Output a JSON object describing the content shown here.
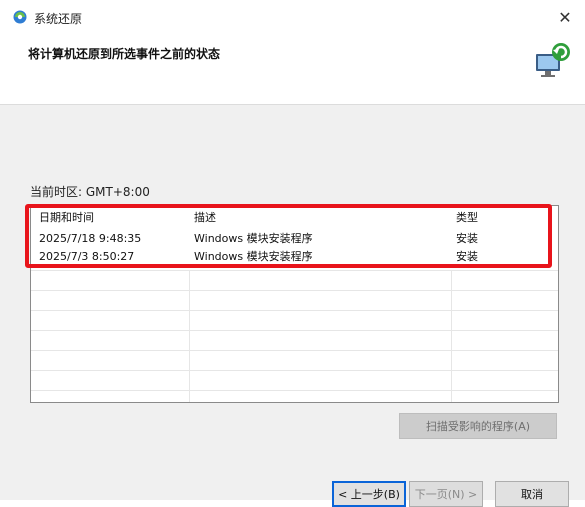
{
  "window": {
    "title": "系统还原",
    "close_glyph": "✕"
  },
  "header": {
    "heading": "将计算机还原到所选事件之前的状态"
  },
  "timezone": {
    "label": "当前时区: GMT+8:00"
  },
  "table": {
    "columns": [
      "日期和时间",
      "描述",
      "类型"
    ],
    "rows": [
      [
        "2025/7/18 9:48:35",
        "Windows 模块安装程序",
        "安装"
      ],
      [
        "2025/7/3 8:50:27",
        "Windows 模块安装程序",
        "安装"
      ]
    ]
  },
  "buttons": {
    "scan": "扫描受影响的程序(A)",
    "back": "< 上一步(B)",
    "next": "下一页(N) >",
    "cancel": "取消"
  },
  "colors": {
    "highlight": "#e8141b",
    "focus": "#0a64d8"
  }
}
